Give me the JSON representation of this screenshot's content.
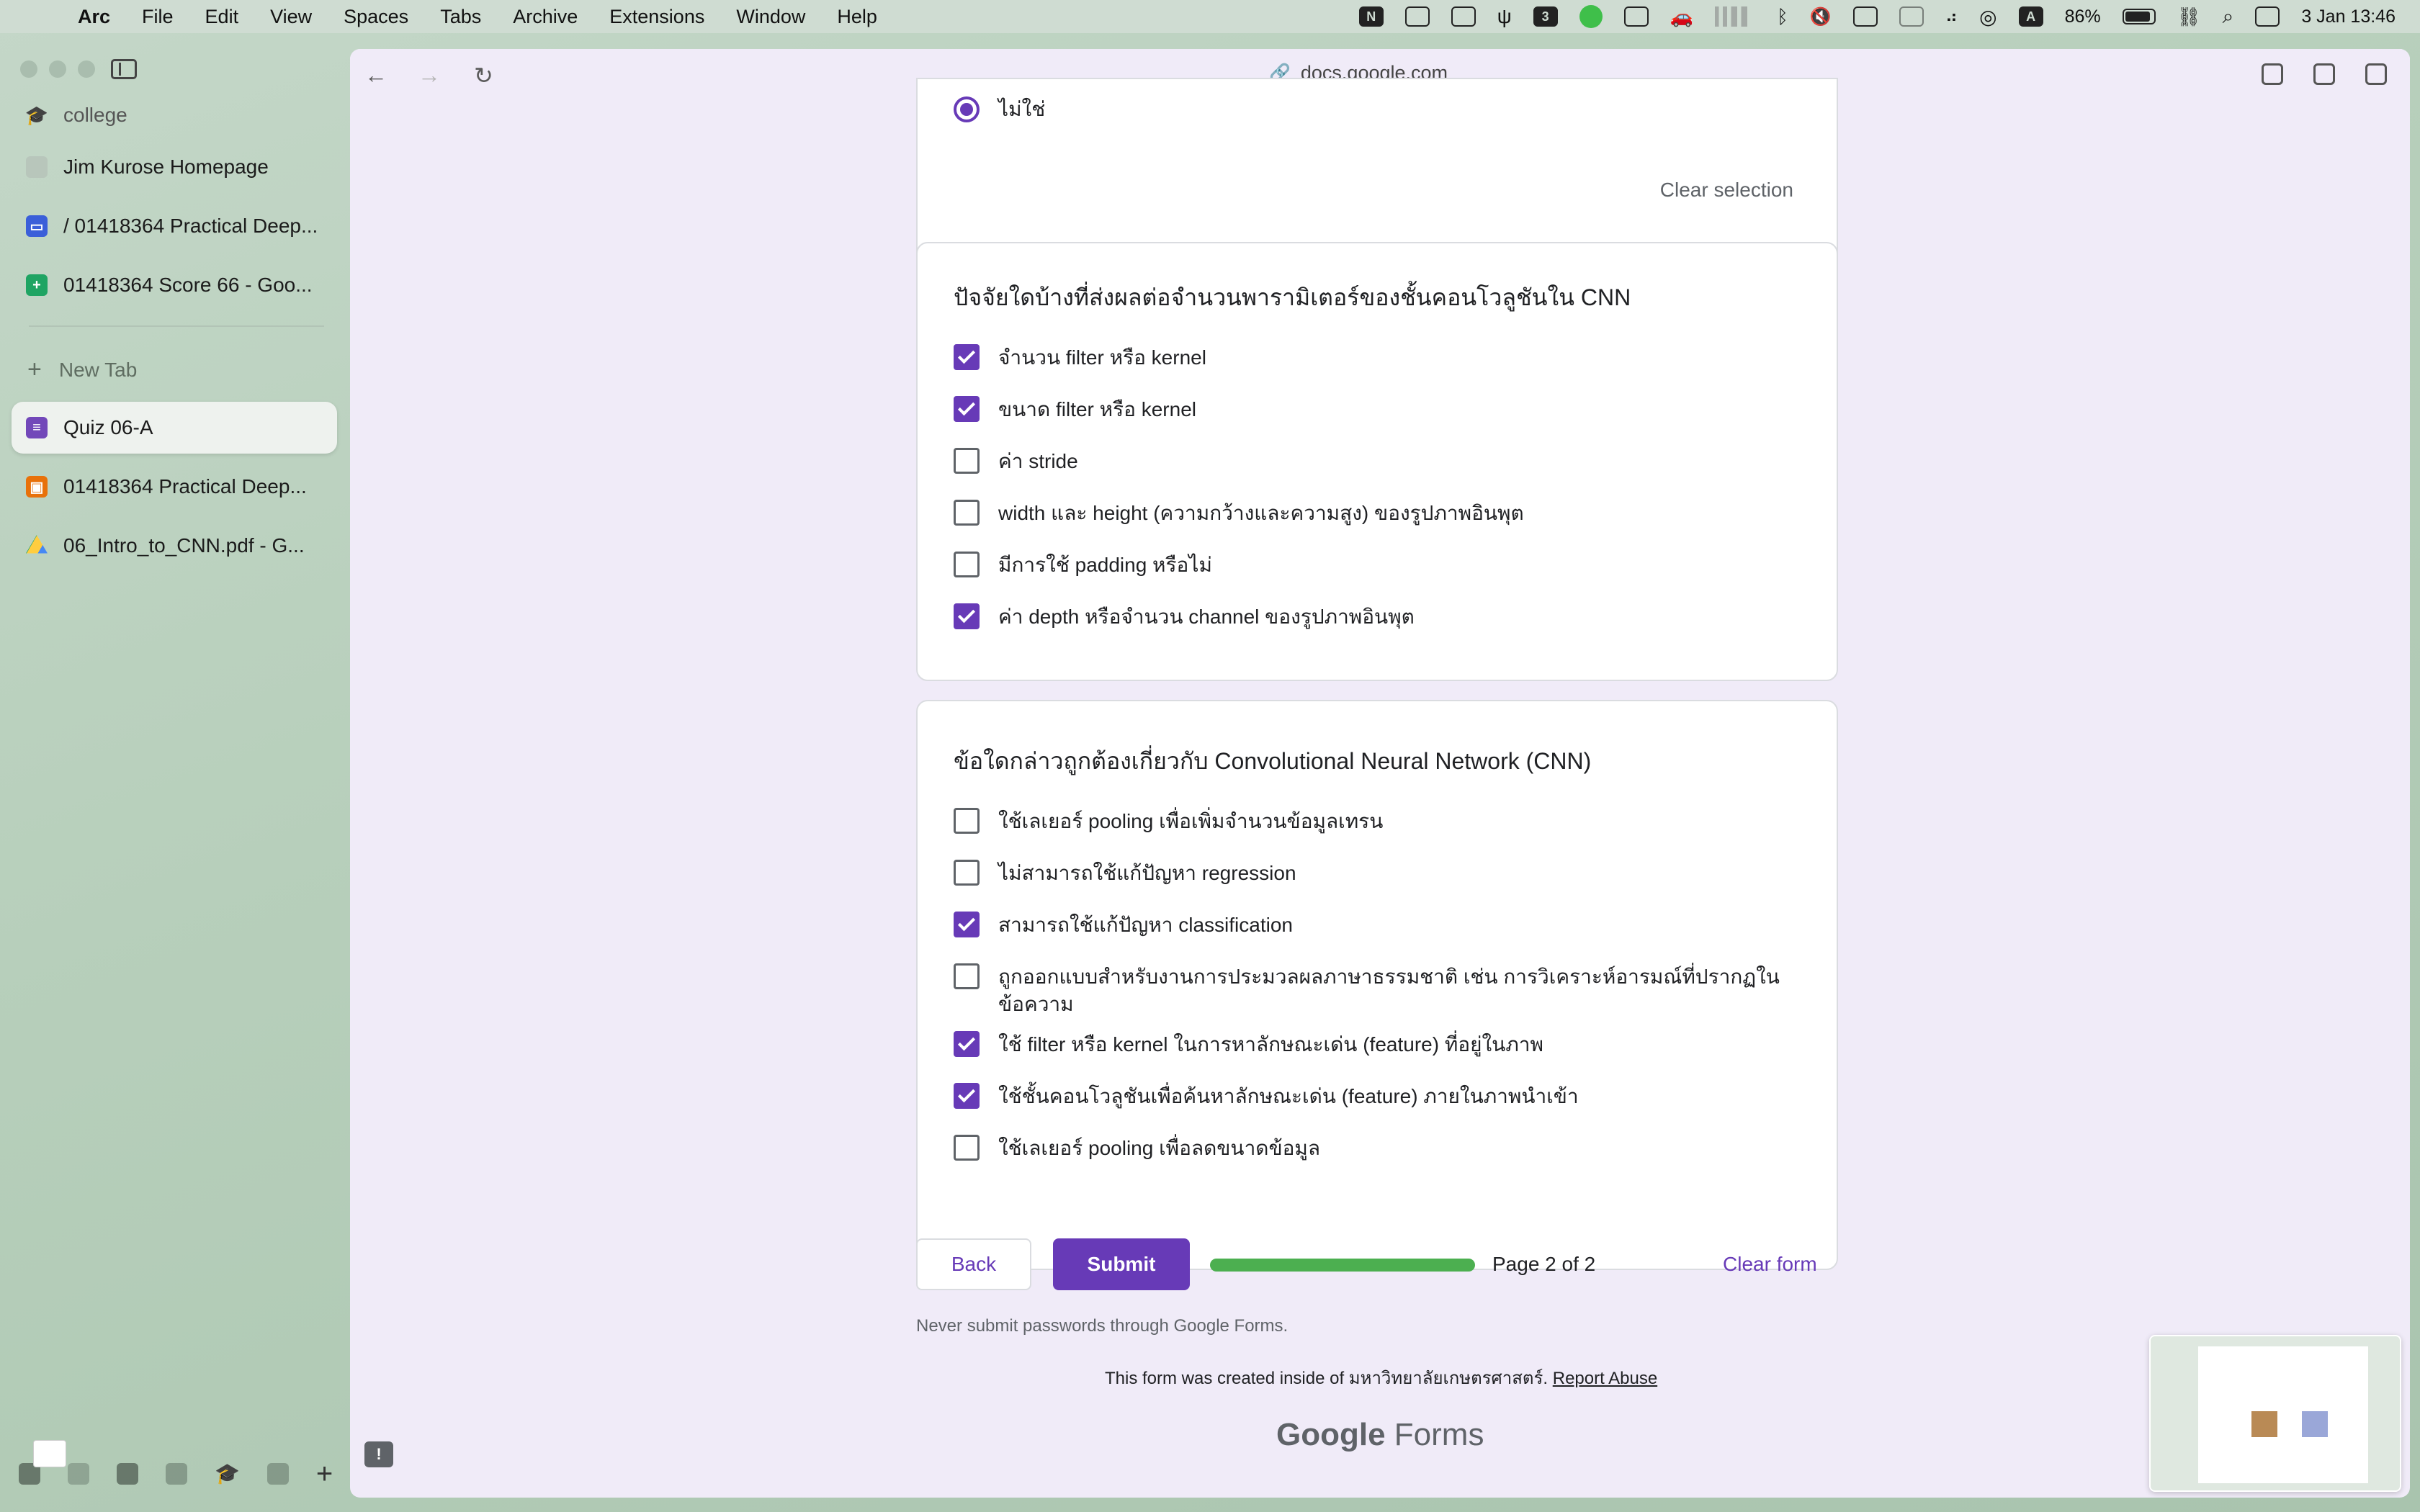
{
  "menubar": {
    "app": "Arc",
    "items": [
      "File",
      "Edit",
      "View",
      "Spaces",
      "Tabs",
      "Archive",
      "Extensions",
      "Window",
      "Help"
    ],
    "battery": "86%",
    "date_time": "3 Jan  13:46",
    "badge_number": "3",
    "input_letter": "A",
    "notion_letter": "N"
  },
  "sidebar": {
    "pinned": [
      {
        "label": "college",
        "icon": "graduation-cap-icon"
      },
      {
        "label": "Jim Kurose Homepage",
        "icon": "page-icon"
      },
      {
        "label": "/ 01418364 Practical Deep...",
        "icon": "classroom-icon"
      },
      {
        "label": "01418364 Score 66 - Goo...",
        "icon": "sheets-icon"
      }
    ],
    "new_tab": "New Tab",
    "tabs": [
      {
        "label": "Quiz 06-A",
        "icon": "forms-icon",
        "active": true
      },
      {
        "label": "01418364 Practical Deep...",
        "icon": "classroom-icon"
      },
      {
        "label": "06_Intro_to_CNN.pdf - G...",
        "icon": "drive-icon"
      }
    ]
  },
  "browser": {
    "url": "docs.google.com"
  },
  "form": {
    "prev_question": {
      "selected_option": "ไม่ใช่",
      "clear_selection": "Clear selection"
    },
    "question1": {
      "title": "ปัจจัยใดบ้างที่ส่งผลต่อจำนวนพารามิเตอร์ของชั้นคอนโวลูชันใน CNN",
      "options": [
        {
          "text": "จำนวน filter หรือ kernel",
          "checked": true
        },
        {
          "text": "ขนาด filter หรือ kernel",
          "checked": true
        },
        {
          "text": "ค่า stride",
          "checked": false
        },
        {
          "text": "width และ height (ความกว้างและความสูง) ของรูปภาพอินพุต",
          "checked": false
        },
        {
          "text": "มีการใช้ padding หรือไม่",
          "checked": false
        },
        {
          "text": "ค่า depth หรือจำนวน channel ของรูปภาพอินพุต",
          "checked": true
        }
      ]
    },
    "question2": {
      "title": "ข้อใดกล่าวถูกต้องเกี่ยวกับ Convolutional Neural Network (CNN)",
      "options": [
        {
          "text": "ใช้เลเยอร์ pooling เพื่อเพิ่มจำนวนข้อมูลเทรน",
          "checked": false
        },
        {
          "text": "ไม่สามารถใช้แก้ปัญหา regression",
          "checked": false
        },
        {
          "text": "สามารถใช้แก้ปัญหา classification",
          "checked": true
        },
        {
          "text": "ถูกออกแบบสำหรับงานการประมวลผลภาษาธรรมชาติ เช่น การวิเคราะห์อารมณ์ที่ปรากฏในข้อความ",
          "checked": false
        },
        {
          "text": "ใช้ filter หรือ kernel ในการหาลักษณะเด่น (feature) ที่อยู่ในภาพ",
          "checked": true
        },
        {
          "text": "ใช้ชั้นคอนโวลูชันเพื่อค้นหาลักษณะเด่น (feature) ภายในภาพนำเข้า",
          "checked": true
        },
        {
          "text": "ใช้เลเยอร์ pooling เพื่อลดขนาดข้อมูล",
          "checked": false
        }
      ]
    },
    "back_label": "Back",
    "submit_label": "Submit",
    "progress_fraction": 1.0,
    "page_indicator": "Page 2 of 2",
    "clear_form": "Clear form",
    "password_warning": "Never submit passwords through Google Forms.",
    "footer_prefix": "This form was created inside of มหาวิทยาลัยเกษตรศาสตร์.",
    "report_abuse": "Report Abuse",
    "logo_google": "Google",
    "logo_forms": "Forms"
  },
  "colors": {
    "accent": "#673ab7",
    "progress": "#4caf50",
    "page_bg": "#f0ebf8"
  }
}
